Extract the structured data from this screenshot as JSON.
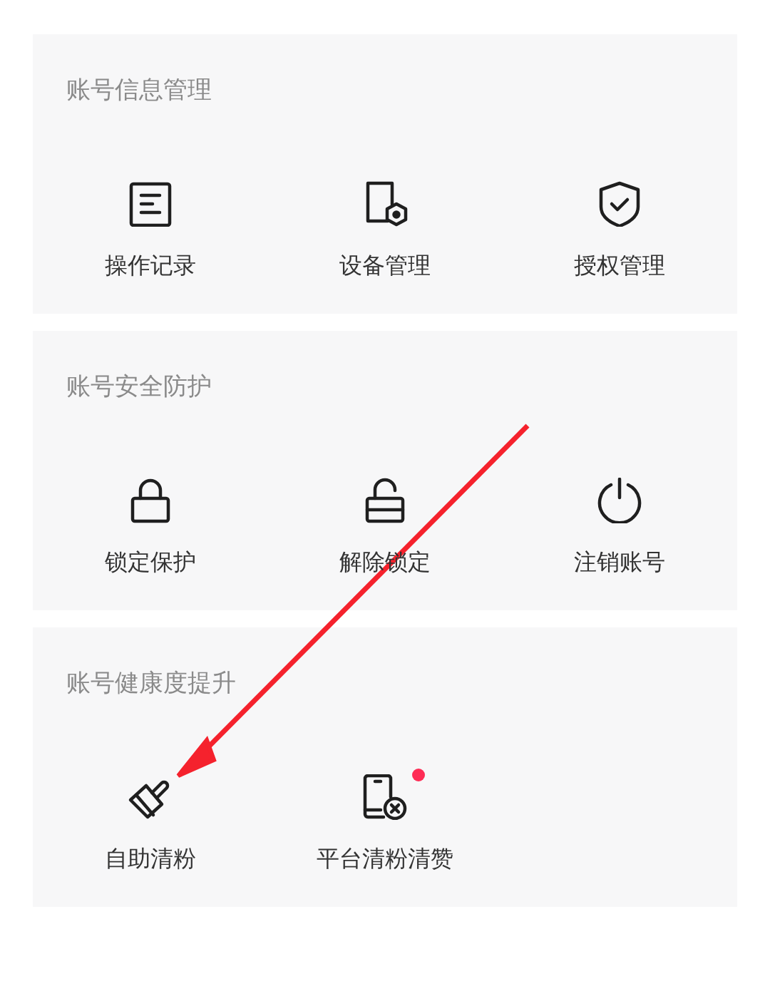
{
  "sections": [
    {
      "title": "账号信息管理",
      "items": [
        {
          "label": "操作记录",
          "kind": "record",
          "badge": false
        },
        {
          "label": "设备管理",
          "kind": "device",
          "badge": false
        },
        {
          "label": "授权管理",
          "kind": "shield",
          "badge": false
        }
      ]
    },
    {
      "title": "账号安全防护",
      "items": [
        {
          "label": "锁定保护",
          "kind": "lock",
          "badge": false
        },
        {
          "label": "解除锁定",
          "kind": "unlock",
          "badge": false
        },
        {
          "label": "注销账号",
          "kind": "power",
          "badge": false
        }
      ]
    },
    {
      "title": "账号健康度提升",
      "items": [
        {
          "label": "自助清粉",
          "kind": "brush",
          "badge": false
        },
        {
          "label": "平台清粉清赞",
          "kind": "phonex",
          "badge": true
        }
      ]
    }
  ],
  "annotation": {
    "kind": "arrow",
    "color": "#f5222d"
  }
}
